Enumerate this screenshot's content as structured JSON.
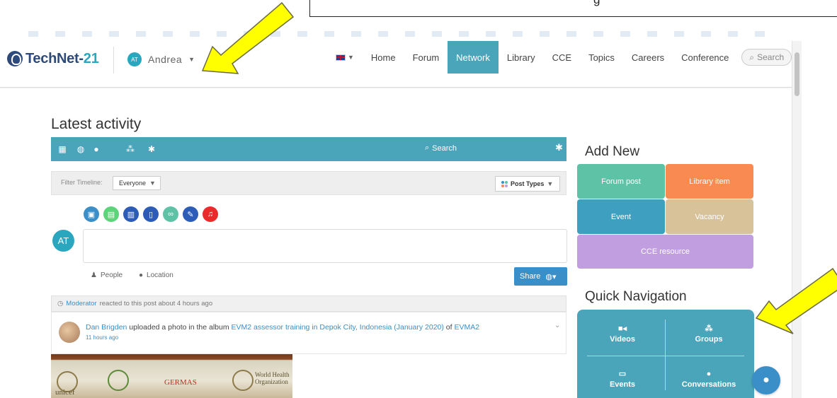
{
  "callout": {
    "text": "g"
  },
  "header": {
    "logo_text": "TechNet-",
    "logo_num": "21",
    "user": {
      "initials": "AT",
      "name": "Andrea"
    },
    "language_flag": "uk-flag",
    "nav": [
      {
        "label": "Home",
        "active": false
      },
      {
        "label": "Forum",
        "active": false
      },
      {
        "label": "Network",
        "active": true
      },
      {
        "label": "Library",
        "active": false
      },
      {
        "label": "CCE",
        "active": false
      },
      {
        "label": "Topics",
        "active": false
      },
      {
        "label": "Careers",
        "active": false
      },
      {
        "label": "Conference",
        "active": false
      }
    ],
    "search_label": "Search"
  },
  "main": {
    "title": "Latest activity",
    "toolbar": {
      "search_label": "Search"
    },
    "filter": {
      "label": "Filter Timeline:",
      "selected": "Everyone",
      "post_types": "Post Types"
    },
    "composer": {
      "avatar_initials": "AT",
      "people_label": "People",
      "location_label": "Location",
      "share_label": "Share"
    },
    "moderator_bar": {
      "actor": "Moderator",
      "text": "reacted to this post about 4 hours ago"
    },
    "post": {
      "author": "Dan Brigden",
      "action": "uploaded a photo in the album",
      "album": "EVM2 assessor training in Depok City, Indonesia (January 2020)",
      "of": "of",
      "group": "EVMA2",
      "time": "11 hours ago"
    },
    "photo_labels": [
      "unicef",
      "GERMAS",
      "World Health Organization"
    ]
  },
  "sidebar": {
    "add_new_title": "Add New",
    "tiles": [
      {
        "label": "Forum post",
        "color": "#5ec2a6"
      },
      {
        "label": "Library item",
        "color": "#f98a52"
      },
      {
        "label": "Event",
        "color": "#3f9fc0"
      },
      {
        "label": "Vacancy",
        "color": "#d8c29a"
      },
      {
        "label": "CCE resource",
        "color": "#c09ee0"
      }
    ],
    "quick_nav_title": "Quick Navigation",
    "quick_nav": [
      {
        "label": "Videos",
        "icon": "video-icon"
      },
      {
        "label": "Groups",
        "icon": "groups-icon"
      },
      {
        "label": "Events",
        "icon": "calendar-icon"
      },
      {
        "label": "Conversations",
        "icon": "chat-icon"
      }
    ]
  },
  "colors": {
    "accent": "#4aa5bb",
    "link": "#3a8fc9",
    "arrow": "#ffff00"
  }
}
